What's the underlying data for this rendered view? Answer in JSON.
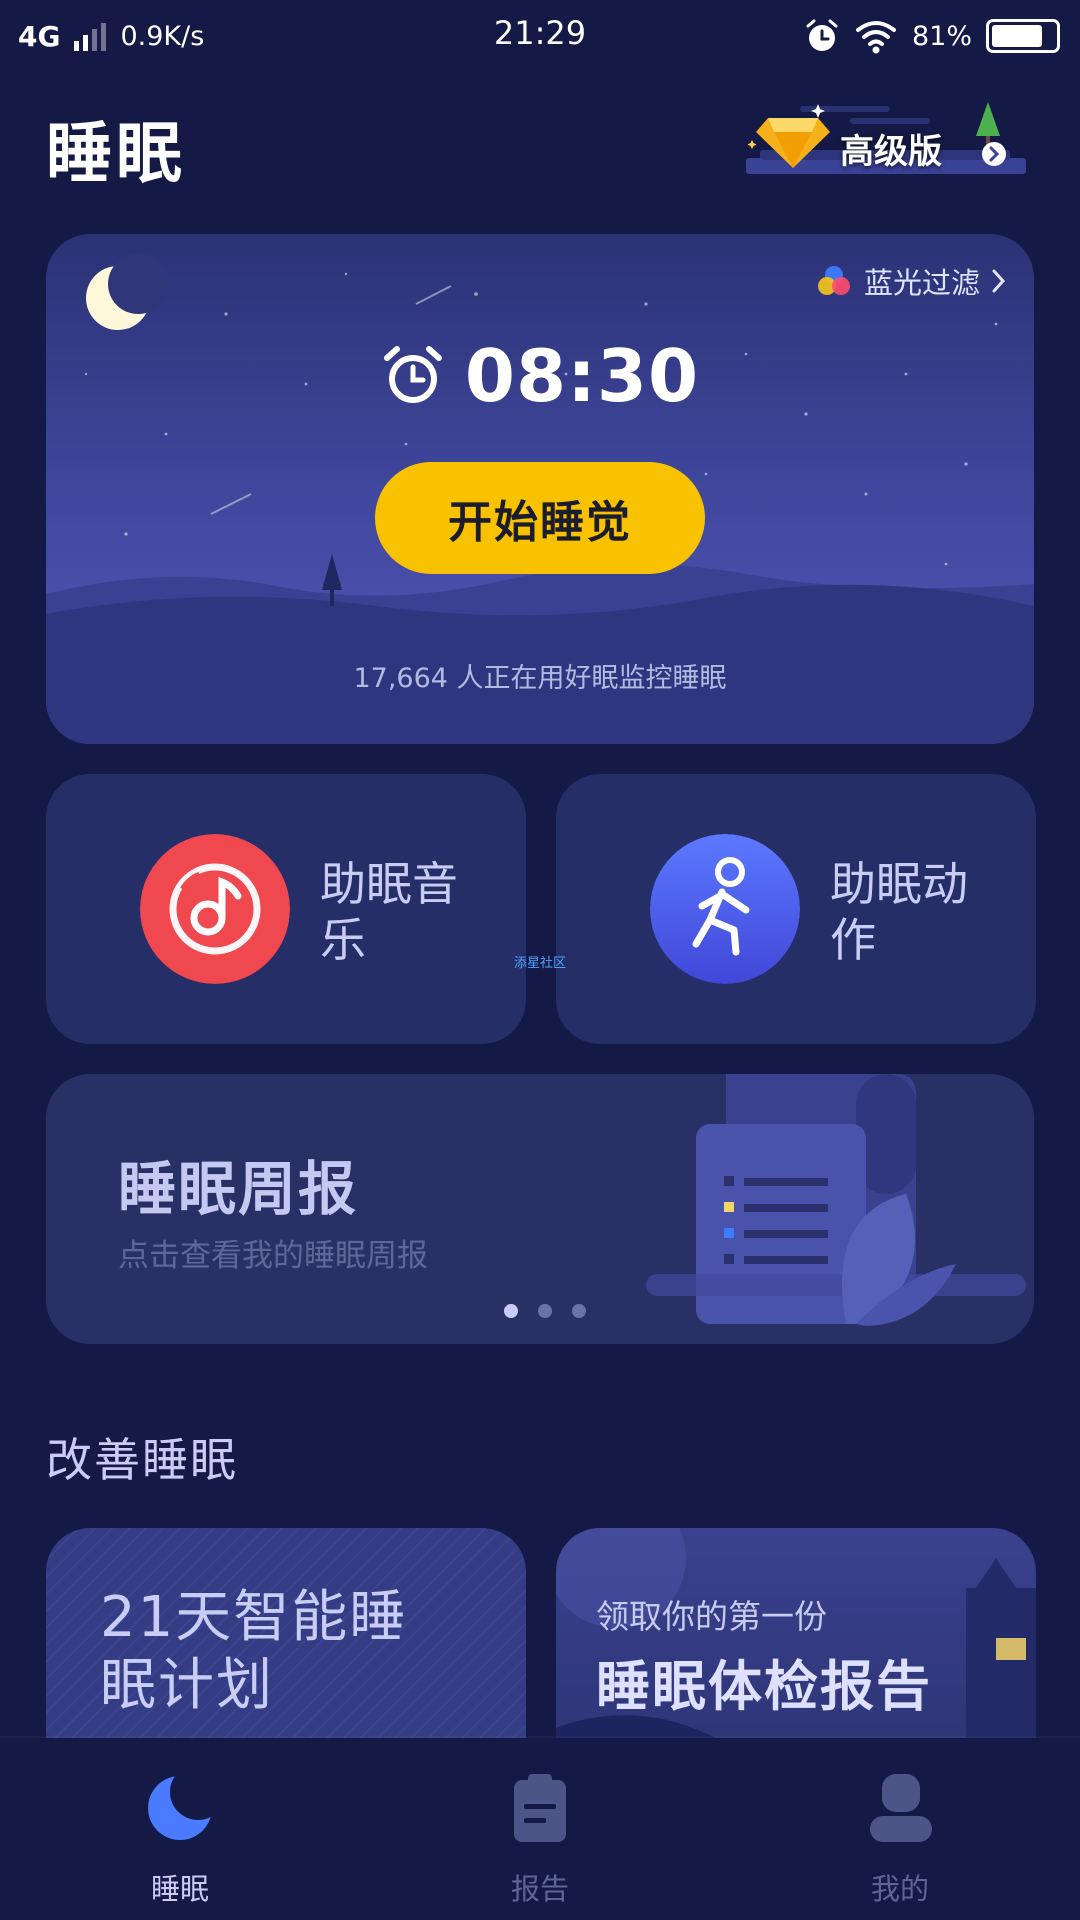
{
  "status_bar": {
    "network": "4G",
    "speed": "0.9K/s",
    "time": "21:29",
    "battery": "81%",
    "battery_level": 0.81
  },
  "header": {
    "title": "睡眠",
    "premium_label": "高级版"
  },
  "sleep_card": {
    "blue_filter_label": "蓝光过滤",
    "alarm_time": "08:30",
    "start_button": "开始睡觉",
    "user_count": "17,664 人正在用好眠监控睡眠"
  },
  "features": {
    "music_label": "助眠音乐",
    "exercise_label": "助眠动作",
    "music_color": "#f0484f",
    "exercise_color": "#4a62f2"
  },
  "watermark": "添星社区",
  "weekly_report": {
    "title": "睡眠周报",
    "subtitle": "点击查看我的睡眠周报",
    "page_count": 3,
    "active_page": 1
  },
  "improve": {
    "section_title": "改善睡眠",
    "plan_card": "21天智能睡眠计划",
    "exam_card_sub": "领取你的第一份",
    "exam_card_title": "睡眠体检报告"
  },
  "bottom_nav": {
    "items": [
      {
        "label": "睡眠",
        "icon": "moon-icon",
        "active": true
      },
      {
        "label": "报告",
        "icon": "clipboard-icon",
        "active": false
      },
      {
        "label": "我的",
        "icon": "user-icon",
        "active": false
      }
    ]
  },
  "colors": {
    "background": "#141a45",
    "accent_yellow": "#f9c200",
    "nav_active": "#4a7bff"
  }
}
